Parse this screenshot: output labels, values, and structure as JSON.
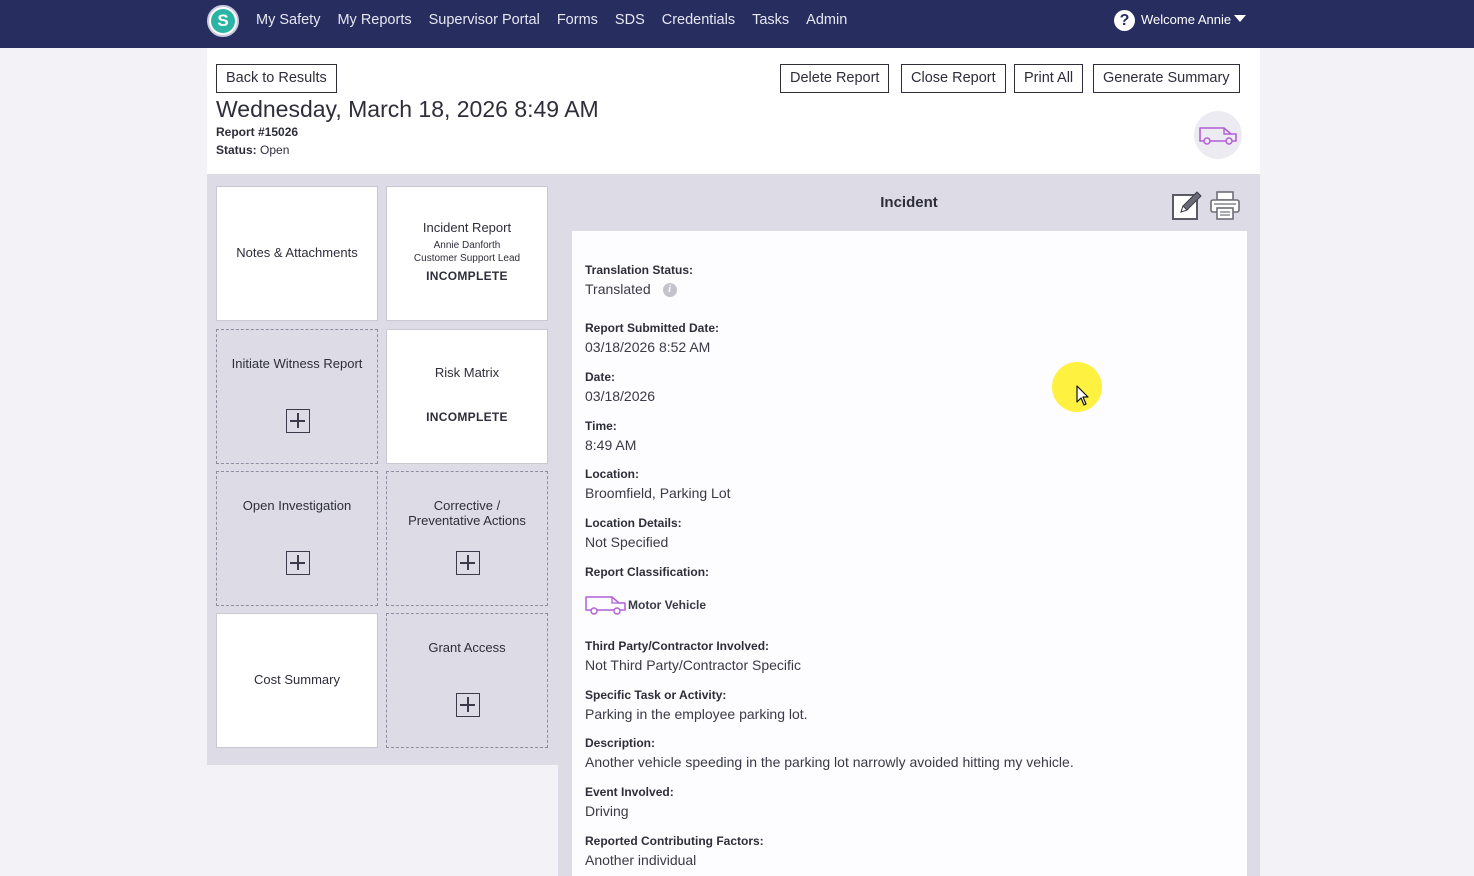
{
  "nav": {
    "logo_letter": "S",
    "links": [
      "My Safety",
      "My Reports",
      "Supervisor Portal",
      "Forms",
      "SDS",
      "Credentials",
      "Tasks",
      "Admin"
    ],
    "help_symbol": "?",
    "welcome": "Welcome Annie"
  },
  "header": {
    "back_label": "Back to Results",
    "delete_label": "Delete Report",
    "close_label": "Close Report",
    "print_all_label": "Print All",
    "summary_label": "Generate Summary",
    "title": "Wednesday, March 18, 2026 8:49 AM",
    "report_label": "Report #15026",
    "status_label": "Status:",
    "status_value": "Open",
    "badge_icon": "van-icon"
  },
  "tiles": {
    "notes": {
      "label": "Notes & Attachments"
    },
    "incident": {
      "label": "Incident Report",
      "person": "Annie Danforth",
      "role": "Customer Support Lead",
      "status": "INCOMPLETE"
    },
    "witness": {
      "label": "Initiate Witness Report"
    },
    "risk": {
      "label": "Risk Matrix",
      "status": "INCOMPLETE"
    },
    "investigation": {
      "label": "Open Investigation"
    },
    "corrective": {
      "label_line1": "Corrective /",
      "label_line2": "Preventative Actions"
    },
    "cost": {
      "label": "Cost Summary"
    },
    "grant": {
      "label": "Grant Access"
    }
  },
  "incident": {
    "title": "Incident",
    "info_symbol": "i",
    "fields": {
      "translation_status": {
        "label": "Translation Status:",
        "value": "Translated"
      },
      "submitted_date": {
        "label": "Report Submitted Date:",
        "value": "03/18/2026 8:52 AM"
      },
      "date": {
        "label": "Date:",
        "value": "03/18/2026"
      },
      "time": {
        "label": "Time:",
        "value": "8:49 AM"
      },
      "location": {
        "label": "Location:",
        "value": "Broomfield, Parking Lot"
      },
      "location_details": {
        "label": "Location Details:",
        "value": "Not Specified"
      },
      "classification": {
        "label": "Report Classification:",
        "value": "Motor Vehicle"
      },
      "third_party": {
        "label": "Third Party/Contractor Involved:",
        "value": "Not Third Party/Contractor Specific"
      },
      "task": {
        "label": "Specific Task or Activity:",
        "value": "Parking in the employee parking lot."
      },
      "description": {
        "label": "Description:",
        "value": "Another vehicle speeding in the parking lot narrowly avoided hitting my vehicle."
      },
      "event": {
        "label": "Event Involved:",
        "value": "Driving"
      },
      "factors": {
        "label": "Reported Contributing Factors:",
        "value": "Another individual"
      }
    }
  },
  "colors": {
    "nav_bg": "#272d5e",
    "panel_bg": "#dcdbe6",
    "logo_accent": "#2bb3a3",
    "van_purple": "#b25fd6"
  }
}
